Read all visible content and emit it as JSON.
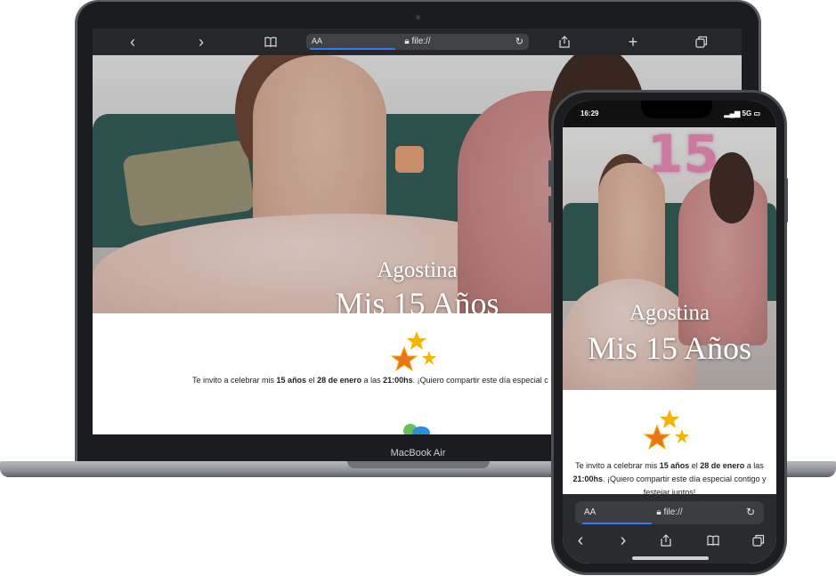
{
  "laptop": {
    "label": "MacBook Air",
    "browser": {
      "aa_label": "AA",
      "url": "file://",
      "lock_icon": "lock-icon",
      "back": "‹",
      "forward": "›",
      "bookmarks_icon": "book-icon",
      "share_icon": "share-icon",
      "new_tab": "+",
      "tabs_icon": "tabs-icon",
      "reload_icon": "reload-icon"
    },
    "page": {
      "hero_subtitle": "Agostina",
      "hero_title": "Mis 15 Años",
      "invite": {
        "part1": "Te invito a celebrar mis ",
        "bold1": "15 años",
        "part2": " el ",
        "bold2": "28 de enero",
        "part3": " a las ",
        "bold3": "21:00hs",
        "part4": ". ¡Quiero compartir este día especial c"
      }
    }
  },
  "phone": {
    "status": {
      "time": "16:29",
      "signal": "5G"
    },
    "page": {
      "balloon_text": "15",
      "hero_subtitle": "Agostina",
      "hero_title": "Mis 15 Años",
      "invite": {
        "part1": "Te invito a celebrar mis ",
        "bold1": "15 años",
        "part2": " el ",
        "bold2": "28 de enero",
        "part3": " a las ",
        "bold3": "21:00hs",
        "part4": ". ¡Quiero compartir este día especial contigo y festejar juntos!"
      }
    },
    "browser": {
      "aa_label": "AA",
      "url": "file://",
      "back": "‹",
      "forward": "›"
    }
  },
  "colors": {
    "star_gold": "#f4b400",
    "star_orange": "#e8741c",
    "accent_blue": "#2f7bf6"
  }
}
